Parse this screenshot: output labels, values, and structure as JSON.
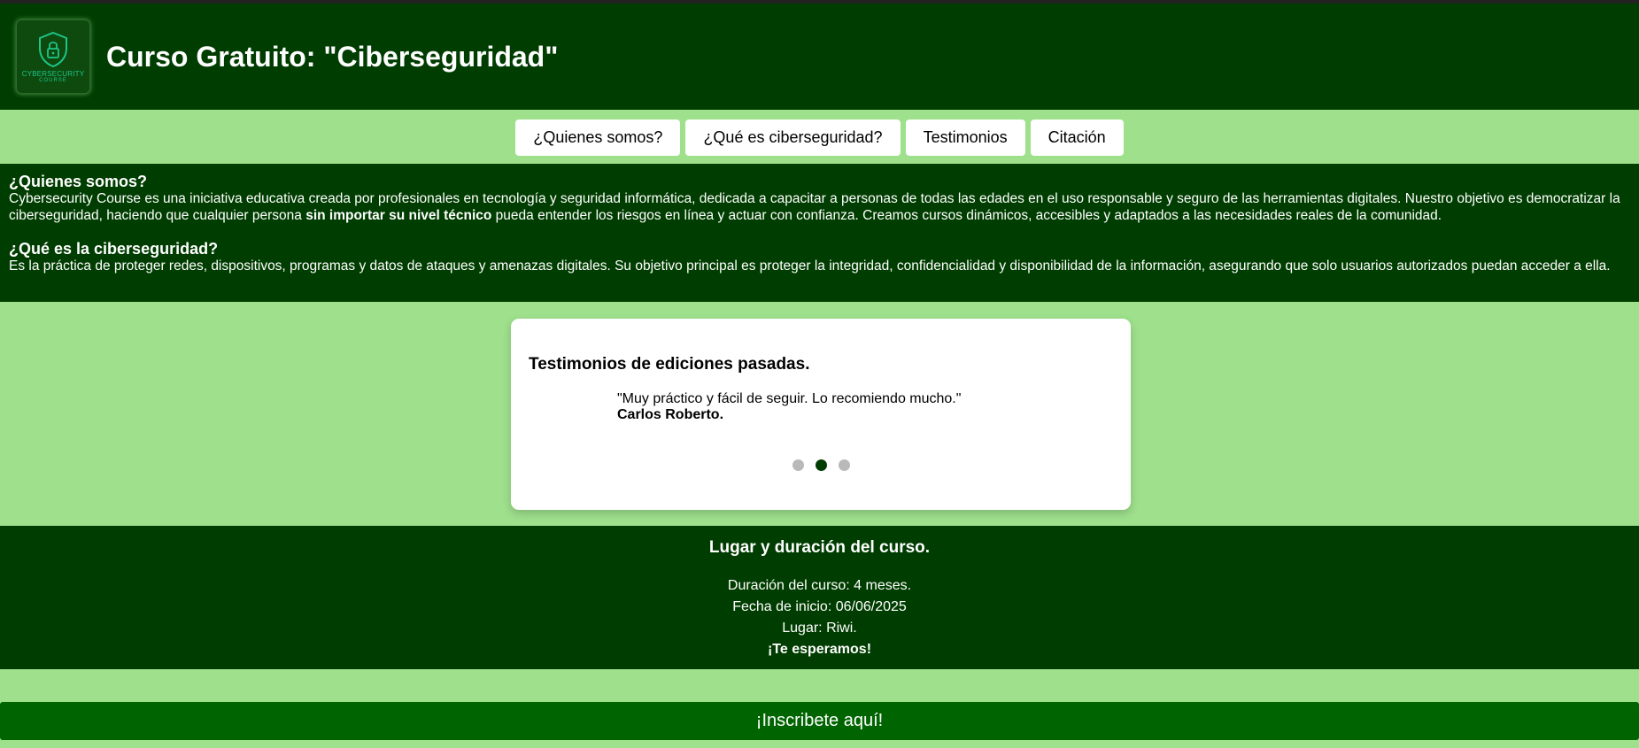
{
  "header": {
    "logo_line1": "CYBERSECURITY",
    "logo_line2": "COURSE",
    "title": "Curso Gratuito: \"Ciberseguridad\""
  },
  "nav": {
    "items": [
      {
        "label": "¿Quienes somos?"
      },
      {
        "label": "¿Qué es ciberseguridad?"
      },
      {
        "label": "Testimonios"
      },
      {
        "label": "Citación"
      }
    ]
  },
  "about": {
    "heading1": "¿Quienes somos?",
    "text1_before": "Cybersecurity Course es una iniciativa educativa creada por profesionales en tecnología y seguridad informática, dedicada a capacitar a personas de todas las edades en el uso responsable y seguro de las herramientas digitales. Nuestro objetivo es democratizar la ciberseguridad, haciendo que cualquier persona ",
    "text1_bold": "sin importar su nivel técnico",
    "text1_after": " pueda entender los riesgos en línea y actuar con confianza. Creamos cursos dinámicos, accesibles y adaptados a las necesidades reales de la comunidad.",
    "heading2": "¿Qué es la ciberseguridad?",
    "text2": "Es la práctica de proteger redes, dispositivos, programas y datos de ataques y amenazas digitales. Su objetivo principal es proteger la integridad, confidencialidad y disponibilidad de la información, asegurando que solo usuarios autorizados puedan acceder a ella."
  },
  "testimonials": {
    "title": "Testimonios de ediciones pasadas.",
    "quote": "\"Muy práctico y fácil de seguir. Lo recomiendo mucho.\"",
    "author": "Carlos Roberto.",
    "active_slide": 2,
    "total_slides": 3
  },
  "info": {
    "title": "Lugar y duración del curso.",
    "duration": "Duración del curso: 4 meses.",
    "start_date": "Fecha de inicio: 06/06/2025",
    "place": "Lugar: Riwi.",
    "closing": "¡Te esperamos!"
  },
  "cta": {
    "label": "¡Inscribete aquí!"
  },
  "colors": {
    "dark_green": "#003d00",
    "light_green": "#9ee08c",
    "cta_green": "#006400"
  }
}
